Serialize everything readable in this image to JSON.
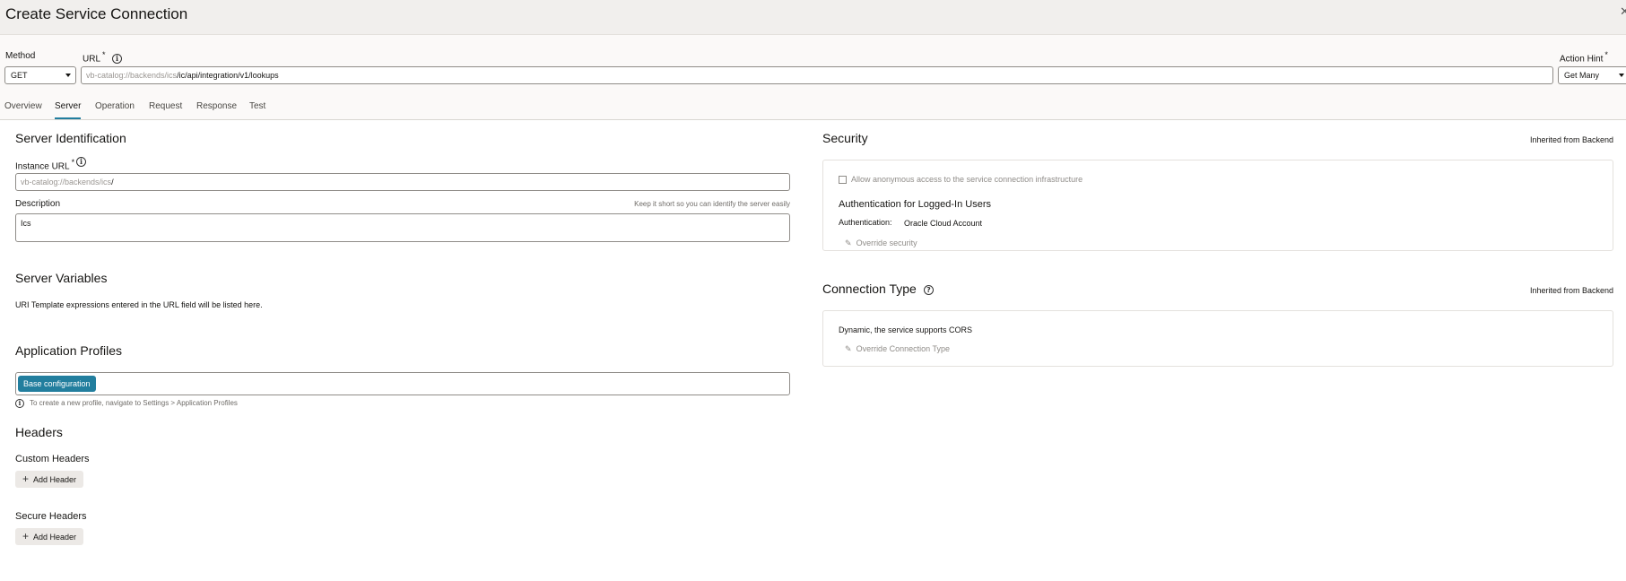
{
  "window": {
    "title": "Create Service Connection"
  },
  "request": {
    "method_label": "Method",
    "method_value": "GET",
    "url_label": "URL",
    "url_required": "*",
    "url_prefix": "vb-catalog://backends/ics",
    "url_path": "/ic/api/integration/v1/lookups",
    "action_hint_label": "Action Hint",
    "action_hint_required": "*",
    "action_hint_value": "Get Many"
  },
  "tabs": [
    {
      "label": "Overview"
    },
    {
      "label": "Server"
    },
    {
      "label": "Operation"
    },
    {
      "label": "Request"
    },
    {
      "label": "Response"
    },
    {
      "label": "Test"
    }
  ],
  "server_identification": {
    "heading": "Server Identification",
    "instance_url_label": "Instance URL",
    "instance_url_required": "*",
    "instance_url_prefix": "vb-catalog://backends/ics",
    "instance_url_suffix": "/",
    "description_label": "Description",
    "description_hint": "Keep it short so you can identify the server easily",
    "description_value": "Ics"
  },
  "server_variables": {
    "heading": "Server Variables",
    "text": "URI Template expressions entered in the URL field will be listed here."
  },
  "application_profiles": {
    "heading": "Application Profiles",
    "chip": "Base configuration",
    "hint": "To create a new profile, navigate to Settings > Application Profiles"
  },
  "headers": {
    "heading": "Headers",
    "custom_heading": "Custom Headers",
    "custom_button": "Add Header",
    "secure_heading": "Secure Headers",
    "secure_button": "Add Header"
  },
  "security": {
    "heading": "Security",
    "inherited": "Inherited from Backend",
    "anonymous_label": "Allow anonymous access to the service connection infrastructure",
    "auth_heading": "Authentication for Logged-In Users",
    "auth_label": "Authentication:",
    "auth_value": "Oracle Cloud Account",
    "override_link": "Override security"
  },
  "connection_type": {
    "heading": "Connection Type",
    "inherited": "Inherited from Backend",
    "text": "Dynamic, the service supports CORS",
    "override_link": "Override Connection Type"
  },
  "colors": {
    "accent": "#227e9e",
    "surface": "#fbf9f8"
  }
}
